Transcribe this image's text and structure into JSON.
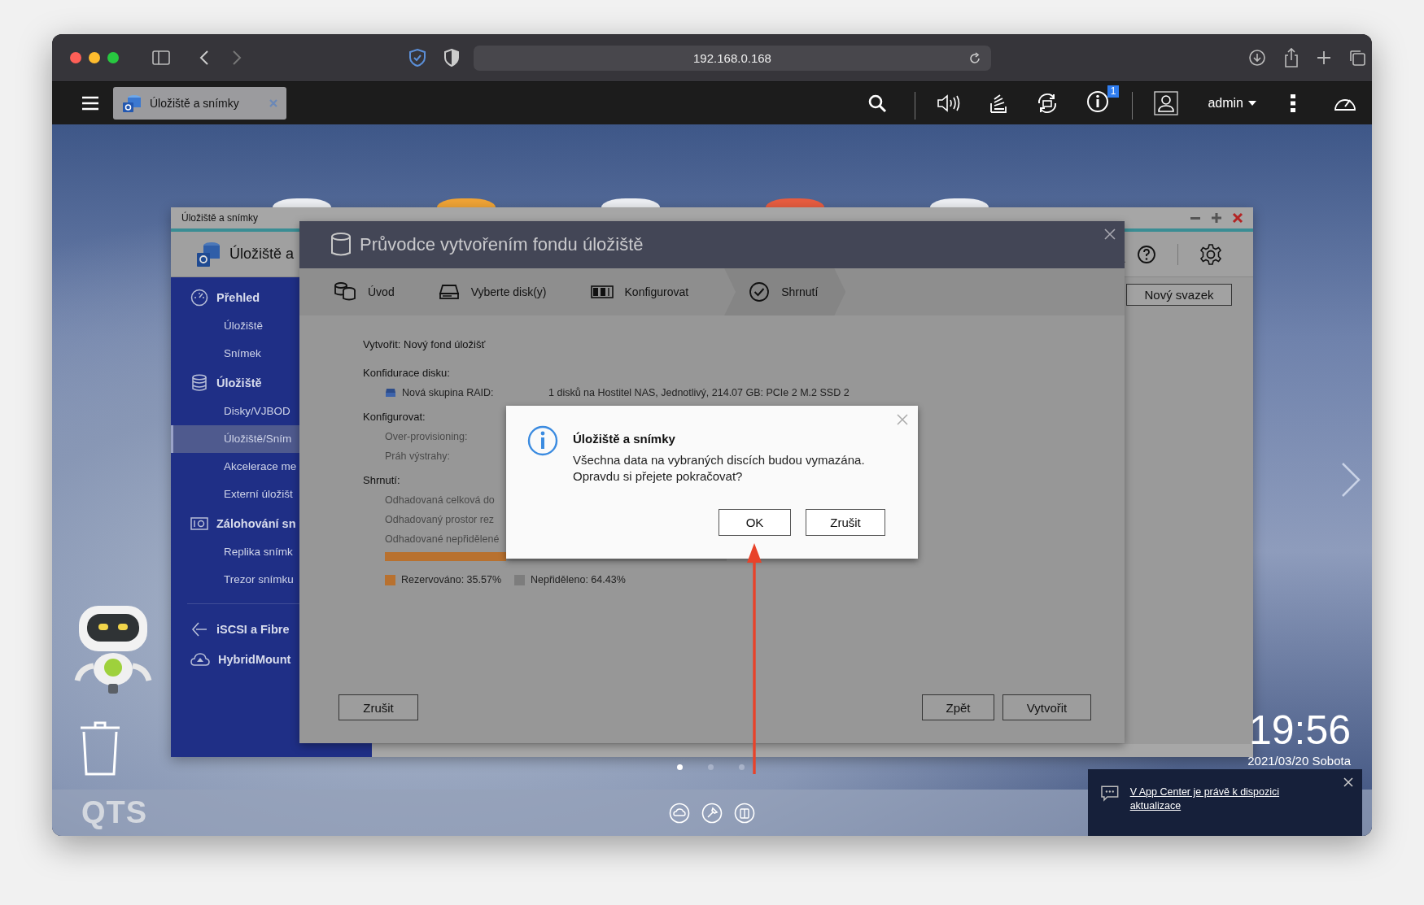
{
  "browser": {
    "url": "192.168.0.168"
  },
  "top_bar": {
    "tabs": [
      {
        "label": "Úložiště a snímky",
        "selected": true
      }
    ],
    "notification_count": "1",
    "user": "admin"
  },
  "app_window": {
    "title": "Úložiště a snímky",
    "header_title": "Úložiště a",
    "new_volume_button": "Nový svazek",
    "sidebar": [
      {
        "groups": [
          {
            "label": "Přehled",
            "children": [
              {
                "label": "Úložiště",
                "selected": false
              },
              {
                "label": "Snímek",
                "selected": false
              }
            ]
          },
          {
            "label": "Úložiště",
            "children": [
              {
                "label": "Disky/VJBOD",
                "selected": false
              },
              {
                "label": "Úložiště/Sním",
                "selected": true
              },
              {
                "label": "Akcelerace me",
                "selected": false
              },
              {
                "label": "Externí úložišt",
                "selected": false
              }
            ]
          },
          {
            "label": "Zálohování sn",
            "children": [
              {
                "label": "Replika snímk",
                "selected": false
              },
              {
                "label": "Trezor snímku",
                "selected": false
              }
            ]
          }
        ]
      },
      {
        "groups": [
          {
            "label": "iSCSI a Fibre"
          },
          {
            "label": "HybridMount"
          }
        ]
      }
    ]
  },
  "wizard": {
    "title": "Průvodce vytvořením fondu úložiště",
    "steps": [
      {
        "label": "Úvod",
        "selected": false
      },
      {
        "label": "Vyberte disk(y)",
        "selected": false
      },
      {
        "label": "Konfigurovat",
        "selected": false
      },
      {
        "label": "Shrnutí",
        "selected": true
      }
    ],
    "heading": "Vytvořit: Nový fond úložišť",
    "sections": [
      {
        "title": "Konfidurace disku:",
        "rows": [
          {
            "kind": "disk",
            "label": "Nová skupina RAID:",
            "value": "1 disků na Hostitel NAS, Jednotlivý, 214.07 GB: PCIe 2 M.2 SSD 2"
          }
        ]
      },
      {
        "title": "Konfigurovat:",
        "rows": [
          {
            "kind": "plain",
            "label": "Over-provisioning:"
          },
          {
            "kind": "plain",
            "label": "Práh výstrahy:"
          }
        ]
      },
      {
        "title": "Shrnutí:",
        "rows": [
          {
            "kind": "plain",
            "label": "Odhadovaná celková do"
          },
          {
            "kind": "plain",
            "label": "Odhadovaný prostor rez"
          },
          {
            "kind": "plain",
            "label": "Odhadované nepřidělené"
          }
        ]
      }
    ],
    "usage": {
      "level": 0.3557,
      "legend": [
        {
          "label": "Rezervováno: 35.57%",
          "color": "#b8712f"
        },
        {
          "label": "Nepřiděleno: 64.43%",
          "color": "#7d7d7d"
        }
      ]
    },
    "buttons": {
      "cancel": "Zrušit",
      "back": "Zpět",
      "create": "Vytvořit"
    }
  },
  "dialog": {
    "title": "Úložiště a snímky",
    "message": [
      "Všechna data na vybraných discích budou vymazána.",
      "Opravdu si přejete pokračovat?"
    ],
    "ok": "OK",
    "cancel": "Zrušit"
  },
  "desktop": {
    "pages": [
      {
        "selected": true
      },
      {
        "selected": false
      },
      {
        "selected": false
      }
    ],
    "time": "19:56",
    "date": "2021/03/20 Sobota",
    "logo": "QTS",
    "notification": {
      "link": "V App Center je právě k dispozici aktualizace"
    }
  }
}
